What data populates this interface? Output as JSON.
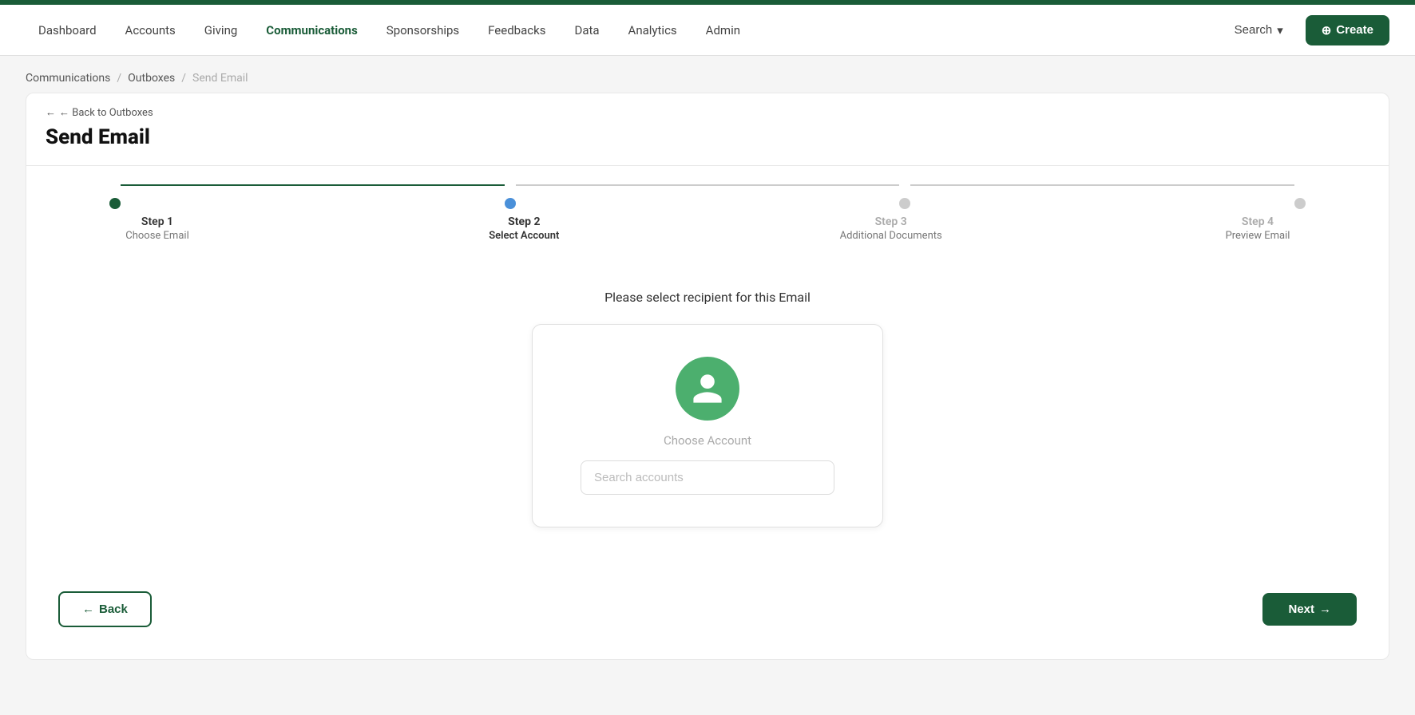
{
  "topbar": {
    "color": "#1a5c38"
  },
  "nav": {
    "items": [
      {
        "label": "Dashboard",
        "active": false
      },
      {
        "label": "Accounts",
        "active": false
      },
      {
        "label": "Giving",
        "active": false
      },
      {
        "label": "Communications",
        "active": true
      },
      {
        "label": "Sponsorships",
        "active": false
      },
      {
        "label": "Feedbacks",
        "active": false
      },
      {
        "label": "Data",
        "active": false
      },
      {
        "label": "Analytics",
        "active": false
      },
      {
        "label": "Admin",
        "active": false
      }
    ],
    "search_label": "Search",
    "create_label": "+ Create"
  },
  "breadcrumb": {
    "items": [
      "Communications",
      "Outboxes",
      "Send Email"
    ]
  },
  "header": {
    "back_label": "← Back to Outboxes",
    "title": "Send Email"
  },
  "stepper": {
    "steps": [
      {
        "number": "Step 1",
        "desc": "Choose Email",
        "state": "completed"
      },
      {
        "number": "Step 2",
        "desc": "Select Account",
        "state": "active"
      },
      {
        "number": "Step 3",
        "desc": "Additional Documents",
        "state": "inactive"
      },
      {
        "number": "Step 4",
        "desc": "Preview Email",
        "state": "inactive"
      }
    ]
  },
  "content": {
    "instruction": "Please select recipient for this Email",
    "choose_label": "Choose Account",
    "search_placeholder": "Search accounts"
  },
  "footer": {
    "back_label": "Back",
    "next_label": "Next"
  }
}
